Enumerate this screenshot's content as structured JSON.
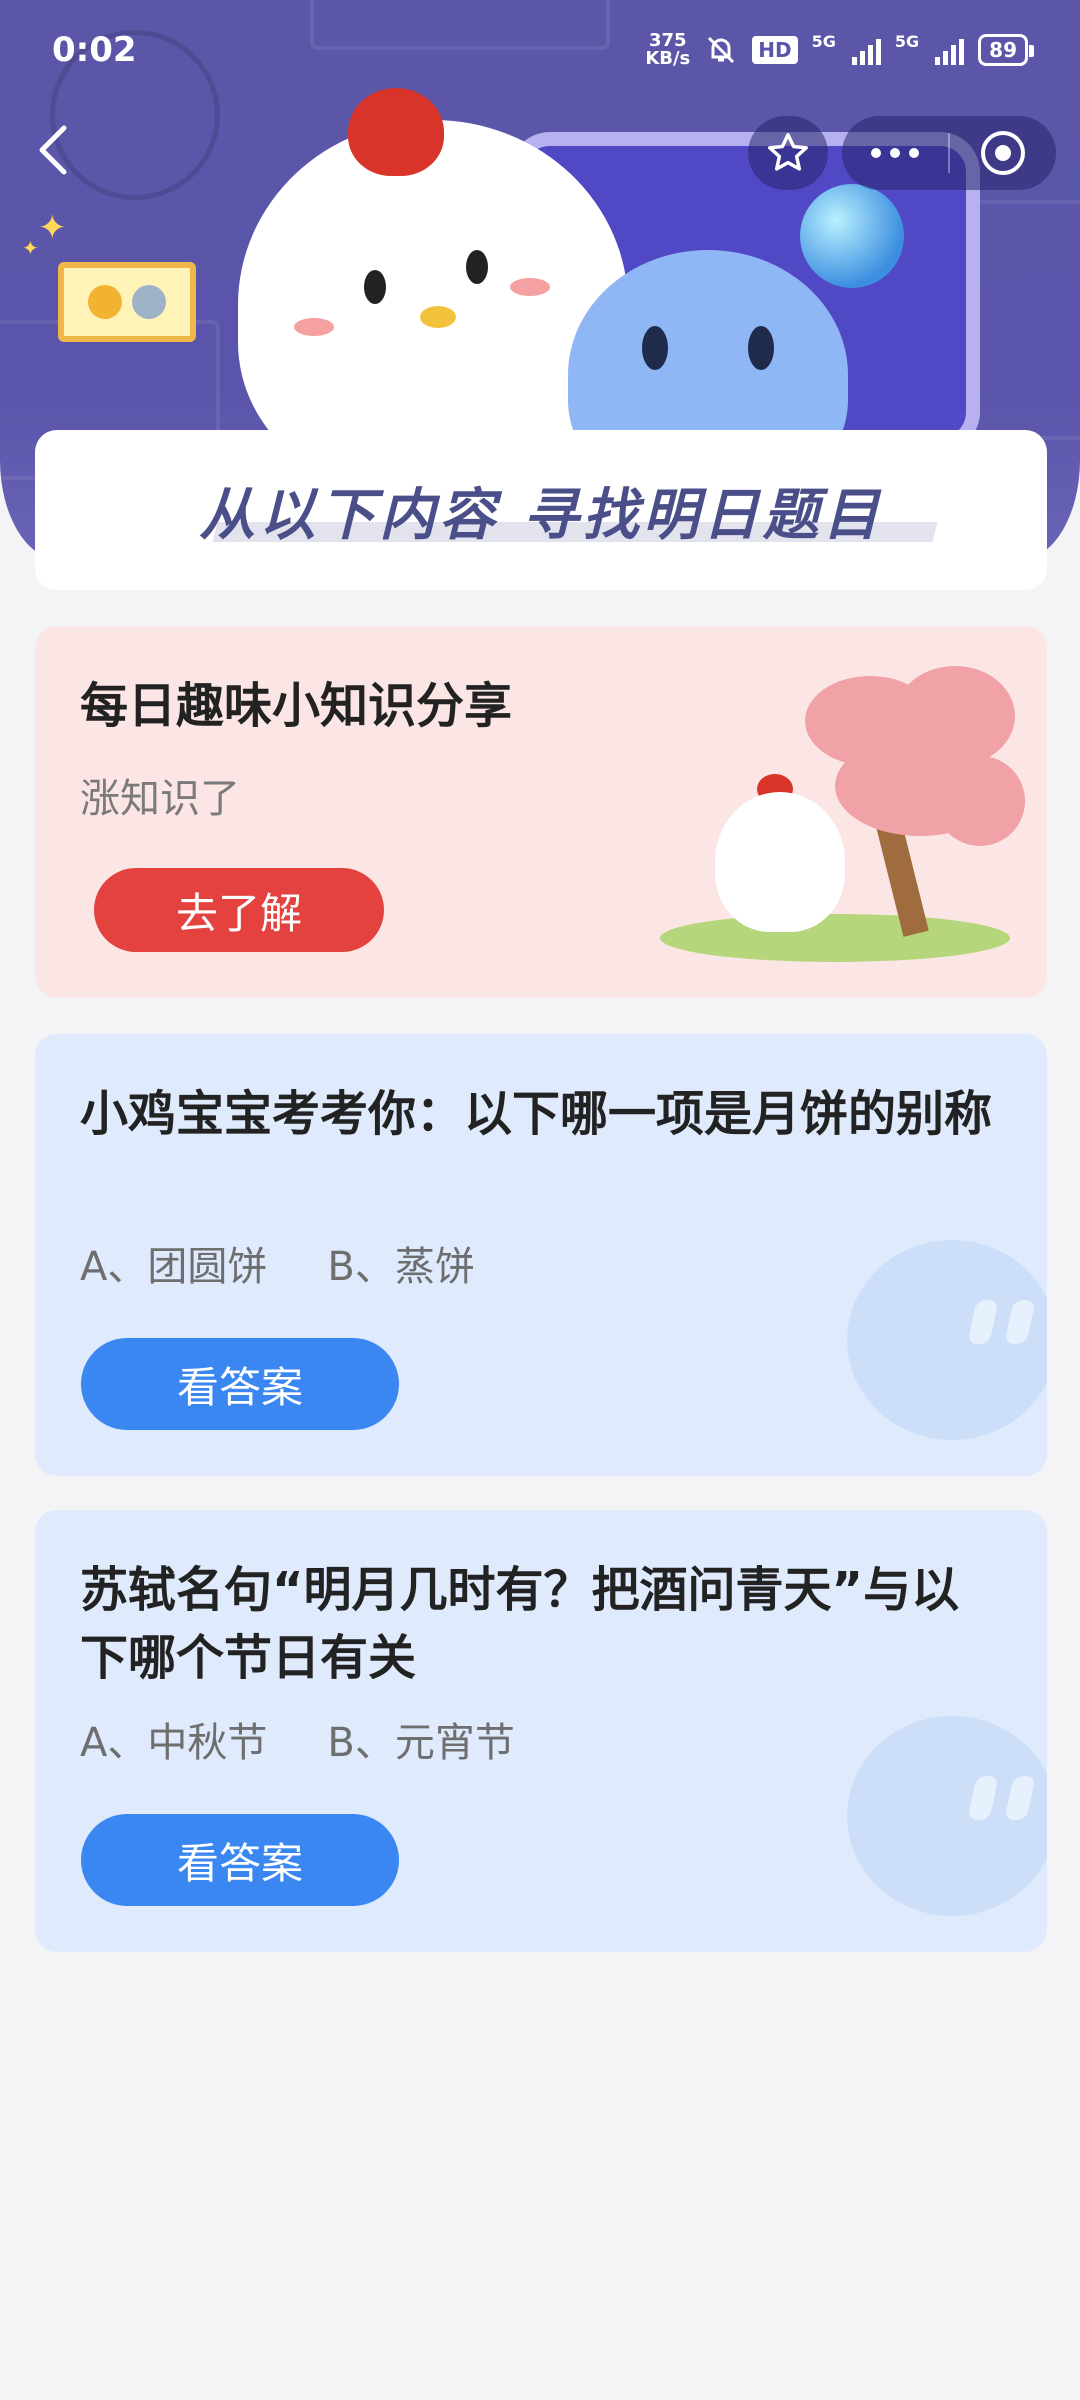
{
  "status_bar": {
    "time": "0:02",
    "net_speed_value": "375",
    "net_speed_unit": "KB/s",
    "hd": "HD",
    "network_1": "5G",
    "network_2": "5G",
    "battery": "89"
  },
  "nav": {
    "back_icon": "chevron-left-icon",
    "favorite_icon": "star-icon",
    "more_icon": "more-dots-icon",
    "close_icon": "target-circle-icon"
  },
  "banner": {
    "title": "从以下内容 寻找明日题目"
  },
  "cards": [
    {
      "title": "每日趣味小知识分享",
      "subtitle": "涨知识了",
      "button": "去了解"
    },
    {
      "question": "小鸡宝宝考考你：以下哪一项是月饼的别称",
      "option_a": "A、团圆饼",
      "option_b": "B、蒸饼",
      "button": "看答案"
    },
    {
      "question": "苏轼名句“明月几时有？把酒问青天”与以下哪个节日有关",
      "option_a": "A、中秋节",
      "option_b": "B、元宵节",
      "button": "看答案"
    }
  ],
  "colors": {
    "banner": "#5b56a8",
    "pink_card": "#fbe6e5",
    "blue_card": "#dfebfd",
    "red_button": "#e4423f",
    "blue_button": "#3a87f1"
  }
}
